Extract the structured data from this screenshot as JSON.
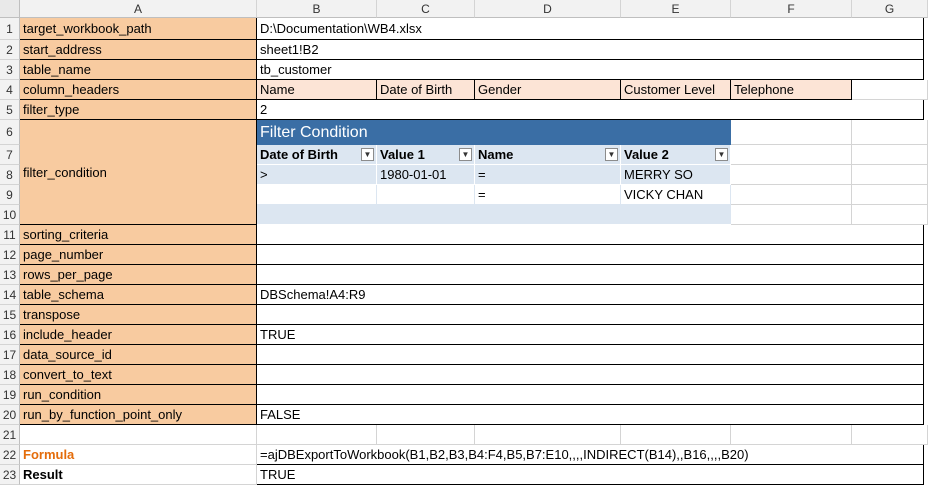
{
  "columns": [
    "A",
    "B",
    "C",
    "D",
    "E",
    "F",
    "G"
  ],
  "rows": [
    {
      "num": "1",
      "label": "target_workbook_path",
      "value": "D:\\Documentation\\WB4.xlsx"
    },
    {
      "num": "2",
      "label": "start_address",
      "value": "sheet1!B2"
    },
    {
      "num": "3",
      "label": "table_name",
      "value": "tb_customer"
    },
    {
      "num": "4",
      "label": "column_headers",
      "value": ""
    },
    {
      "num": "5",
      "label": "filter_type",
      "value": "2"
    },
    {
      "num": "6",
      "label": "",
      "value": ""
    },
    {
      "num": "7",
      "label": "filter_condition",
      "value": ""
    },
    {
      "num": "8",
      "label": "",
      "value": ""
    },
    {
      "num": "9",
      "label": "",
      "value": ""
    },
    {
      "num": "10",
      "label": "",
      "value": ""
    },
    {
      "num": "11",
      "label": "sorting_criteria",
      "value": ""
    },
    {
      "num": "12",
      "label": "page_number",
      "value": ""
    },
    {
      "num": "13",
      "label": "rows_per_page",
      "value": ""
    },
    {
      "num": "14",
      "label": "table_schema",
      "value": "DBSchema!A4:R9"
    },
    {
      "num": "15",
      "label": "transpose",
      "value": ""
    },
    {
      "num": "16",
      "label": "include_header",
      "value": "TRUE"
    },
    {
      "num": "17",
      "label": "data_source_id",
      "value": ""
    },
    {
      "num": "18",
      "label": "convert_to_text",
      "value": ""
    },
    {
      "num": "19",
      "label": "run_condition",
      "value": ""
    },
    {
      "num": "20",
      "label": "run_by_function_point_only",
      "value": "FALSE"
    },
    {
      "num": "21",
      "label": "",
      "value": ""
    },
    {
      "num": "22",
      "label": "Formula",
      "value": "=ajDBExportToWorkbook(B1,B2,B3,B4:F4,B5,B7:E10,,,,INDIRECT(B14),,B16,,,,B20)"
    },
    {
      "num": "23",
      "label": "Result",
      "value": "TRUE"
    }
  ],
  "column_headers": [
    "Name",
    "Date of Birth",
    "Gender",
    "Customer Level",
    "Telephone"
  ],
  "filter_table": {
    "title": "Filter Condition",
    "headers": [
      "Date of Birth",
      "Value 1",
      "Name",
      "Value 2"
    ],
    "rows": [
      [
        ">",
        "1980-01-01",
        "=",
        "MERRY SO"
      ],
      [
        "",
        "",
        "=",
        "VICKY CHAN"
      ],
      [
        "",
        "",
        "",
        ""
      ]
    ]
  },
  "colors": {
    "label_bg": "#f8cba0",
    "header_bg": "#fce4d6",
    "table_title": "#3a6ea5",
    "table_band": "#dce6f1",
    "formula_label": "#e46c0a"
  }
}
